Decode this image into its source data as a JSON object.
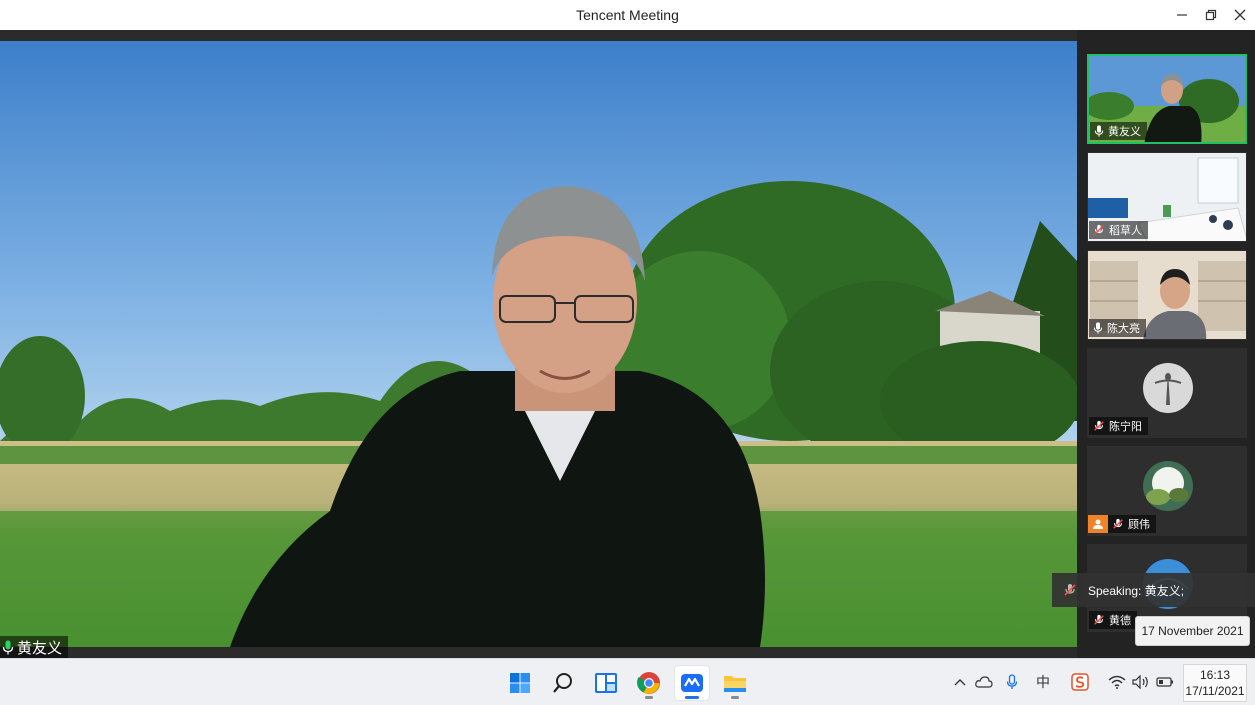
{
  "window": {
    "title": "Tencent Meeting"
  },
  "main_video": {
    "speaker_name": "黄友义"
  },
  "participants": [
    {
      "name": "黄友义",
      "mic": "on",
      "active": true
    },
    {
      "name": "稻草人",
      "mic": "muted",
      "active": false
    },
    {
      "name": "陈大亮",
      "mic": "on",
      "active": false
    },
    {
      "name": "陈宁阳",
      "mic": "muted",
      "active": false
    },
    {
      "name": "顾伟",
      "mic": "muted",
      "active": false,
      "host_badge": true
    },
    {
      "name": "黄德",
      "mic": "muted",
      "active": false
    }
  ],
  "speaking_toast": {
    "text": "Speaking: 黄友义;"
  },
  "tooltip": {
    "text": "17 November 2021"
  },
  "taskbar": {
    "apps": [
      "start-icon",
      "search-icon",
      "widgets-icon",
      "chrome-icon",
      "tencent-meeting-icon",
      "file-explorer-icon"
    ],
    "tray_input_method": "中",
    "clock_time": "16:13",
    "clock_date": "17/11/2021"
  },
  "colors": {
    "active_border": "#21c063",
    "taskbar_bg": "#eef0f3"
  }
}
